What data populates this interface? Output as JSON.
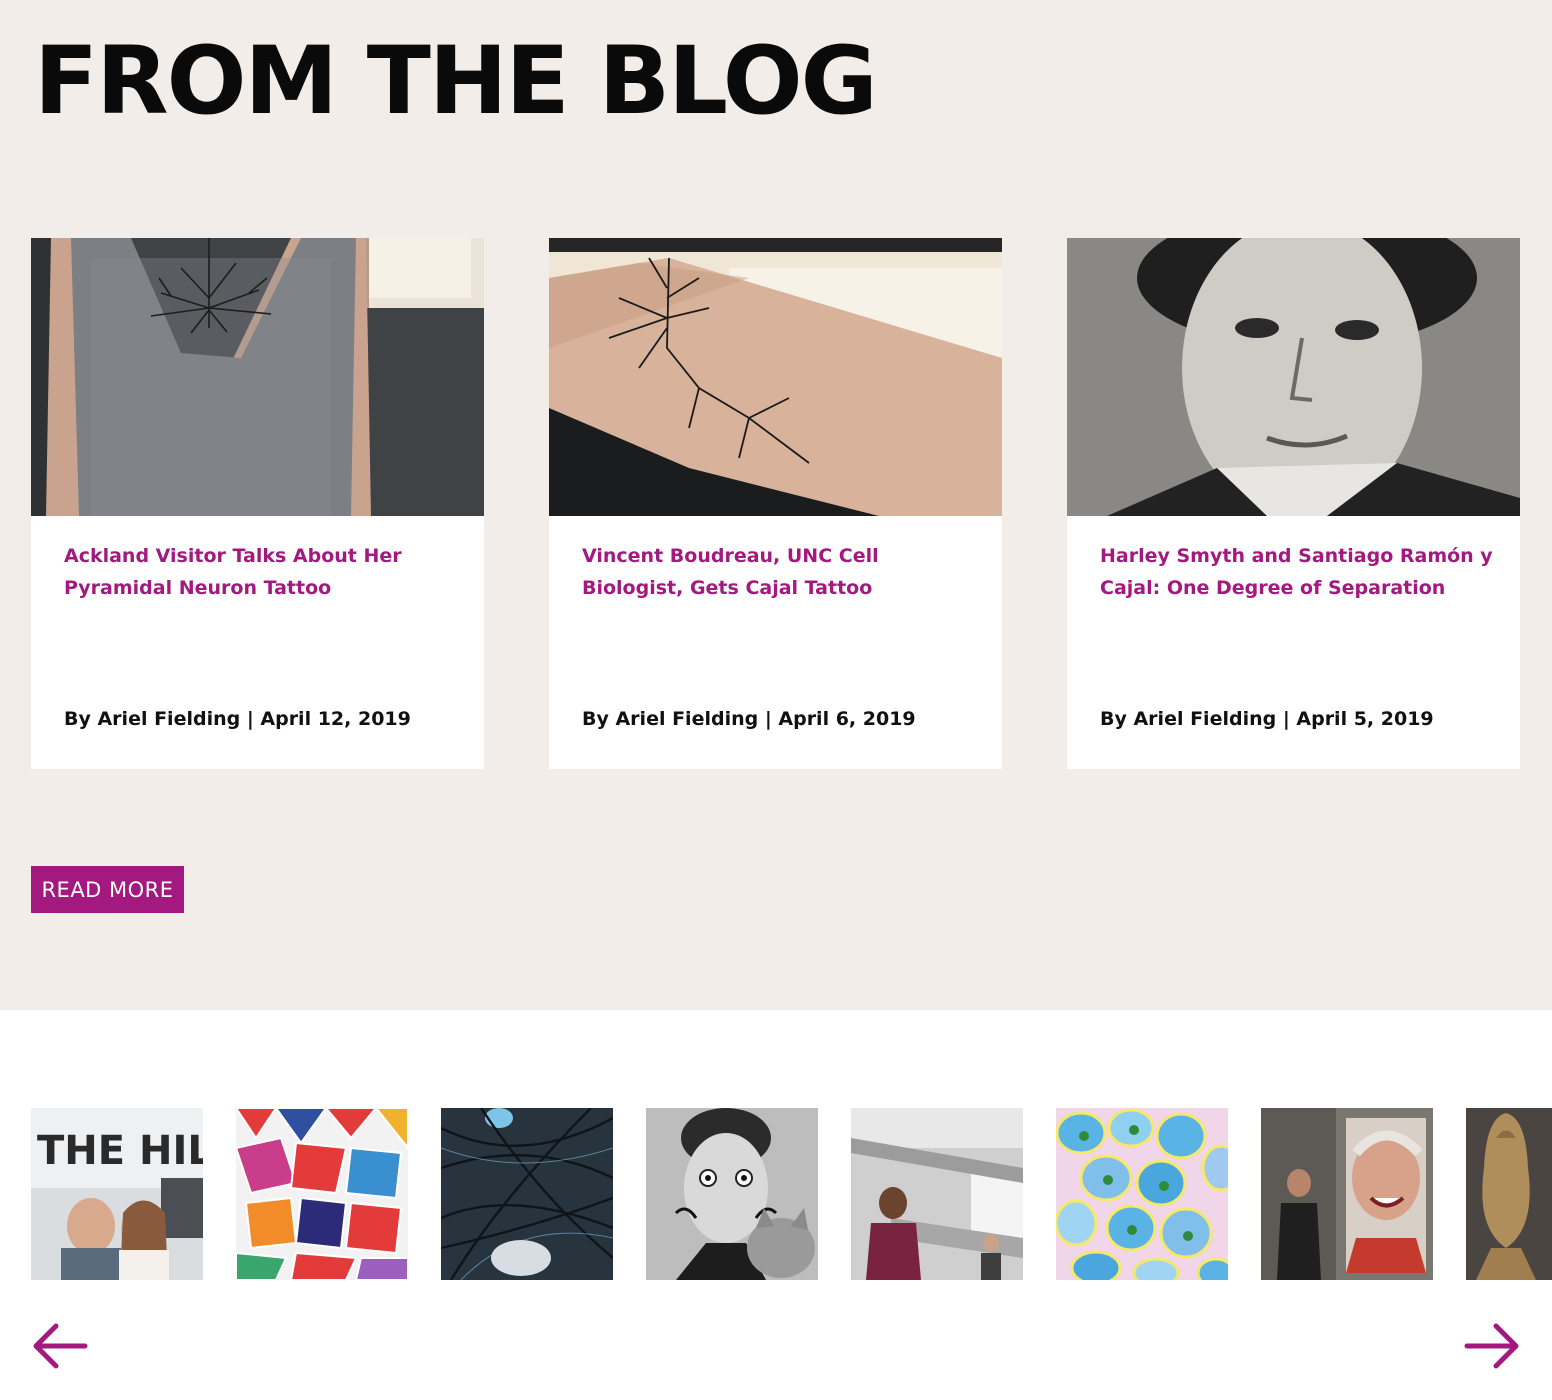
{
  "heading": "FROM THE BLOG",
  "posts": [
    {
      "title": "Ackland Visitor Talks About Her Pyramidal Neuron Tattoo",
      "meta": "By Ariel Fielding | April 12, 2019"
    },
    {
      "title": "Vincent Boudreau, UNC Cell Biologist, Gets Cajal Tattoo",
      "meta": "By Ariel Fielding | April 6, 2019"
    },
    {
      "title": "Harley Smyth and Santiago Ramón y Cajal: One Degree of Separation",
      "meta": "By Ariel Fielding | April 5, 2019"
    }
  ],
  "read_more": "READ MORE",
  "gallery": {
    "thumb1_sign_text": "THE HILL",
    "arrows": {
      "prev_icon": "arrow-left-icon",
      "next_icon": "arrow-right-icon"
    }
  },
  "colors": {
    "accent": "#a3197f",
    "background": "#f2ede9",
    "heading": "#0a0a0a"
  }
}
